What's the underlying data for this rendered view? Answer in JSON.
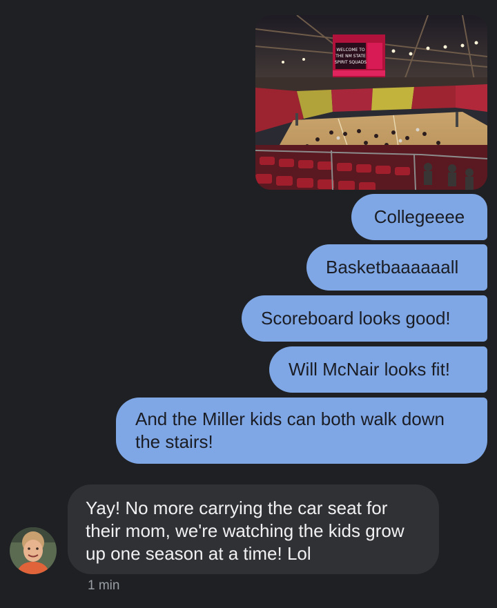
{
  "conversation": {
    "photo": {
      "scoreboard_text": "WELCOME TO THE NM STATE SPIRIT SQUADS"
    },
    "outgoing": [
      {
        "text": "Collegeeee"
      },
      {
        "text": "Basketbaaaaaall"
      },
      {
        "text": "Scoreboard looks good!"
      },
      {
        "text": "Will McNair looks fit!"
      },
      {
        "text": "And the Miller kids can both walk down the stairs!"
      }
    ],
    "incoming": {
      "text": "Yay! No more carrying the car seat for their mom, we're watching the kids grow up one season at a time! Lol",
      "timestamp": "1 min"
    }
  },
  "colors": {
    "background": "#1f2023",
    "outgoing_bubble": "#7fa7e6",
    "incoming_bubble": "#303134",
    "timestamp": "#9aa0a6"
  }
}
